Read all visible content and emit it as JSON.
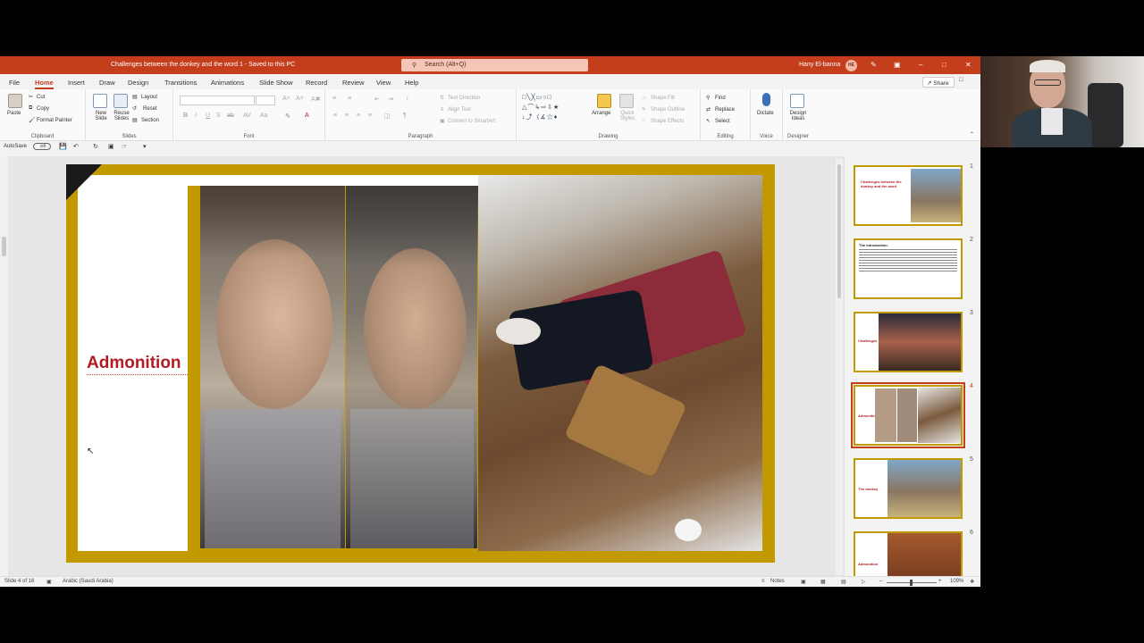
{
  "titlebar": {
    "doc_title": "Challenges between the donkey and the word 1  -  Saved to this PC",
    "search_placeholder": "Search (Alt+Q)",
    "user_name": "Hany El-banna",
    "user_initials": "HE"
  },
  "menu": {
    "tabs": [
      "File",
      "Home",
      "Insert",
      "Draw",
      "Design",
      "Transitions",
      "Animations",
      "Slide Show",
      "Record",
      "Review",
      "View",
      "Help"
    ],
    "active": "Home",
    "share_label": "Share"
  },
  "ribbon": {
    "clipboard": {
      "label": "Clipboard",
      "paste": "Paste",
      "cut": "Cut",
      "copy": "Copy",
      "format_painter": "Format Painter"
    },
    "slides": {
      "label": "Slides",
      "new_slide": "New Slide",
      "reuse_slides": "Reuse Slides",
      "layout": "Layout",
      "reset": "Reset",
      "section": "Section"
    },
    "font": {
      "label": "Font"
    },
    "paragraph": {
      "label": "Paragraph",
      "text_direction": "Text Direction",
      "align_text": "Align Text",
      "convert_smartart": "Convert to SmartArt"
    },
    "drawing": {
      "label": "Drawing",
      "arrange": "Arrange",
      "quick_styles": "Quick Styles",
      "shape_fill": "Shape Fill",
      "shape_outline": "Shape Outline",
      "shape_effects": "Shape Effects"
    },
    "editing": {
      "label": "Editing",
      "find": "Find",
      "replace": "Replace",
      "select": "Select"
    },
    "voice": {
      "label": "Voice",
      "dictate": "Dictate"
    },
    "designer": {
      "label": "Designer",
      "design_ideas": "Design Ideas"
    }
  },
  "qat": {
    "autosave": "AutoSave",
    "toggle": "Off"
  },
  "slide": {
    "title": "Admonition"
  },
  "thumbnails": [
    {
      "num": "1",
      "label": "Challenges between the donkey and the word"
    },
    {
      "num": "2",
      "label": "The introduction:"
    },
    {
      "num": "3",
      "label": "Challenges"
    },
    {
      "num": "4",
      "label": "Admonition"
    },
    {
      "num": "5",
      "label": "The donkey"
    },
    {
      "num": "6",
      "label": "Admonition"
    }
  ],
  "status": {
    "slide_count": "Slide 4 of 16",
    "language": "Arabic (Saudi Arabia)",
    "notes": "Notes",
    "zoom": "109%"
  },
  "colors": {
    "accent": "#c43e1c",
    "slide_gold": "#c29a00",
    "title_red": "#b11c22"
  }
}
